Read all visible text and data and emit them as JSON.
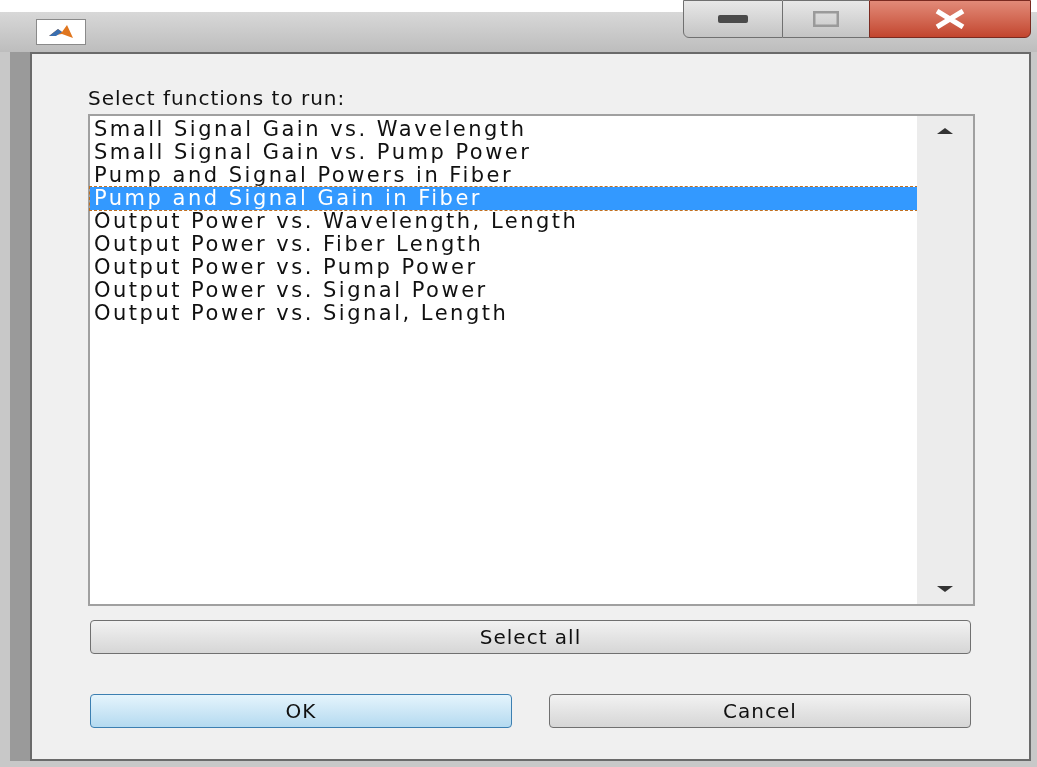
{
  "dialog": {
    "prompt": "Select functions to run:",
    "functions": [
      {
        "label": "Small Signal Gain vs. Wavelength",
        "selected": false
      },
      {
        "label": "Small Signal Gain vs. Pump Power",
        "selected": false
      },
      {
        "label": "Pump and Signal Powers in Fiber",
        "selected": false
      },
      {
        "label": "Pump and Signal Gain in Fiber",
        "selected": true
      },
      {
        "label": "Output Power vs. Wavelength, Length",
        "selected": false
      },
      {
        "label": "Output Power vs. Fiber Length",
        "selected": false
      },
      {
        "label": "Output Power vs. Pump Power",
        "selected": false
      },
      {
        "label": "Output Power vs. Signal Power",
        "selected": false
      },
      {
        "label": "Output Power vs. Signal, Length",
        "selected": false
      }
    ],
    "select_all_button": "Select all",
    "buttons": [
      {
        "label": "OK",
        "kind": "default"
      },
      {
        "label": "Cancel",
        "kind": "normal"
      }
    ]
  }
}
